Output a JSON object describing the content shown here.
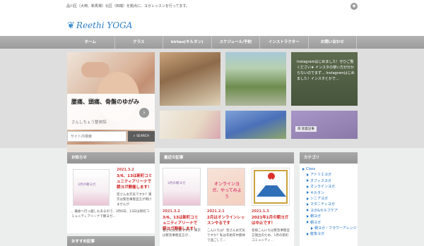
{
  "top": {
    "tagline": "品川区（大崎、新馬場）北区（田端）を拠点に、ヨガレッスンを行ってます。",
    "rss_icon": "rss-icon"
  },
  "header": {
    "logo_text": "Reethi YOGA",
    "logo_mark": "❦"
  },
  "nav": {
    "items": [
      "ホーム",
      "クラス",
      "kirtan(キルタン)",
      "スケジュール/予約",
      "インストラクター",
      "お問い合わせ"
    ]
  },
  "slider": {
    "title": "腰痛、頭痛、骨盤のゆがみ",
    "subtitle": "さんしちょう整体院",
    "next": "›"
  },
  "search": {
    "placeholder": "サイト内検索",
    "button": "SEARCH"
  },
  "feature": {
    "instagram_text": "Instagramはじめました！ぜひご覧ください★ インスタの使い方が分からないのでまず... Instagramはじめました！インスタとかで...",
    "badge": "目 新着記事"
  },
  "news": {
    "heading": "お知らせ",
    "date": "2021.3.2",
    "title": "3/6、13は新町コミュニティアリーナで朝ヨガ開催します！",
    "body": "皆さんお元気ですか？東京は緊急事態宣言が明けませんが",
    "body2": "、鎌倉へ行っ越しもあるので、3月6日、13日は新町コミュニティアリーナで朝ヨガ...",
    "image_label": "3月の朝ヨガ"
  },
  "recommend": {
    "heading": "おすすめ記事"
  },
  "recent": {
    "heading": "最近の記事",
    "posts": [
      {
        "date": "2021.3.2",
        "title": "3/6、13は新町コミュニティアリーナで朝ヨガ開催します！",
        "body": "皆さんお元気ですか？東京は緊急事態宣言が..."
      },
      {
        "date": "2021.2.1",
        "title": "2月はオンラインレッスンやるです",
        "body": "こんにちは！皆さんお元気ですか？私は年始年中無休で過ごして..."
      },
      {
        "date": "2021.1.3",
        "title": "2021年1月の朝ヨガは中止です！",
        "body": "皆様こんにちは緊急事態宣言発出のため、1月の新町コミュニティ..."
      }
    ],
    "image_texts": [
      "3月の朝ヨガ",
      "オンラインヨガ、やってみよう"
    ]
  },
  "category": {
    "heading": "カテゴリ",
    "items": [
      {
        "label": "Class",
        "level": 0
      },
      {
        "label": "アトリエヨガ",
        "level": 1
      },
      {
        "label": "オフィスヨガ",
        "level": 1
      },
      {
        "label": "オンラインヨガ",
        "level": 1
      },
      {
        "label": "キルタン",
        "level": 1
      },
      {
        "label": "シニアヨガ",
        "level": 1
      },
      {
        "label": "マタニティヨガ",
        "level": 1
      },
      {
        "label": "ヨガ&セルフケア",
        "level": 1
      },
      {
        "label": "朝ヨガ",
        "level": 1
      },
      {
        "label": "朝ヨガ",
        "level": 1
      },
      {
        "label": "朝ヨガ・フラワーアレンジ",
        "level": 2
      },
      {
        "label": "産後ヨガ",
        "level": 1
      }
    ]
  }
}
